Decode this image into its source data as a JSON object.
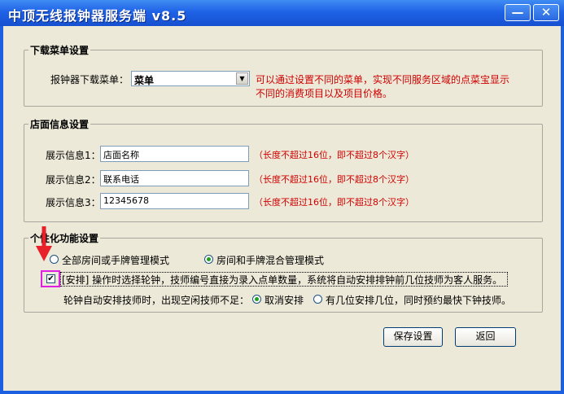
{
  "window": {
    "title": "中顶无线报钟器服务端 v8.5",
    "minimize_glyph": "—",
    "close_glyph": "✕"
  },
  "menu_group": {
    "legend": "下载菜单设置",
    "label": "报钟器下载菜单：",
    "selected": "菜单",
    "hint_line1": "可以通过设置不同的菜单，实现不同服务区域的点菜宝显示",
    "hint_line2": "不同的消费项目以及项目价格。"
  },
  "store_group": {
    "legend": "店面信息设置",
    "rows": [
      {
        "label": "展示信息1：",
        "value": "店面名称",
        "hint": "（长度不超过16位，即不超过8个汉字）"
      },
      {
        "label": "展示信息2：",
        "value": "联系电话",
        "hint": "（长度不超过16位，即不超过8个汉字）"
      },
      {
        "label": "展示信息3：",
        "value": "12345678",
        "hint": "（长度不超过16位，即不超过8个汉字）"
      }
    ]
  },
  "personal_group": {
    "legend": "个性化功能设置",
    "mode_options": [
      {
        "label": "全部房间或手牌管理模式",
        "selected": false
      },
      {
        "label": "房间和手牌混合管理模式",
        "selected": true
      }
    ],
    "arrange_checkbox": {
      "label": "[安排] 操作时选择轮钟，技师编号直接为录入点单数量，系统将自动安排排钟前几位技师为客人服务。",
      "checked": true
    },
    "shortage_label": "轮钟自动安排技师时，出现空闲技师不足：",
    "shortage_options": [
      {
        "label": "取消安排",
        "selected": true
      },
      {
        "label": "有几位安排几位，同时预约最快下钟技师。",
        "selected": false
      }
    ]
  },
  "buttons": {
    "save": "保存设置",
    "back": "返回"
  },
  "colors": {
    "titlebar": "#1f62e6",
    "client_bg": "#ece9d8",
    "hint_red": "#d00000",
    "annotation_arrow": "#e8202a",
    "annotation_box": "#e020e0"
  }
}
